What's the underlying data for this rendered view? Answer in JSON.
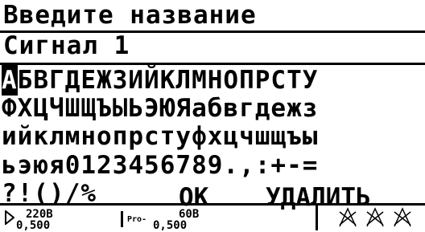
{
  "header": {
    "title": "Введите название"
  },
  "name_field": {
    "value": "Сигнал 1"
  },
  "keyboard": {
    "selected": "А",
    "rows": [
      [
        "А",
        "Б",
        "В",
        "Г",
        "Д",
        "Е",
        "Ж",
        "З",
        "И",
        "Й",
        "К",
        "Л",
        "М",
        "Н",
        "О",
        "П",
        "Р",
        "С",
        "Т",
        "У"
      ],
      [
        "Ф",
        "Х",
        "Ц",
        "Ч",
        "Ш",
        "Щ",
        "Ъ",
        "Ы",
        "Ь",
        "Э",
        "Ю",
        "Я",
        "а",
        "б",
        "в",
        "г",
        "д",
        "е",
        "ж",
        "з"
      ],
      [
        "и",
        "й",
        "к",
        "л",
        "м",
        "н",
        "о",
        "п",
        "р",
        "с",
        "т",
        "у",
        "ф",
        "х",
        "ц",
        "ч",
        "ш",
        "щ",
        "ъ",
        "ы"
      ],
      [
        "ь",
        "э",
        "ю",
        "я",
        "0",
        "1",
        "2",
        "3",
        "4",
        "5",
        "6",
        "7",
        "8",
        "9",
        ".",
        " ",
        ",",
        " ",
        ":",
        "+",
        "-",
        "="
      ],
      [
        "?",
        "!",
        "(",
        ")",
        "/",
        "%"
      ]
    ]
  },
  "actions": {
    "ok": "ОК",
    "delete": "УДАЛИТЬ"
  },
  "status_bar": {
    "left_top": "220В",
    "left_bottom": "0,500",
    "mid_prefix": "Pro-",
    "mid_top": "60В",
    "mid_bottom": "0,500"
  }
}
